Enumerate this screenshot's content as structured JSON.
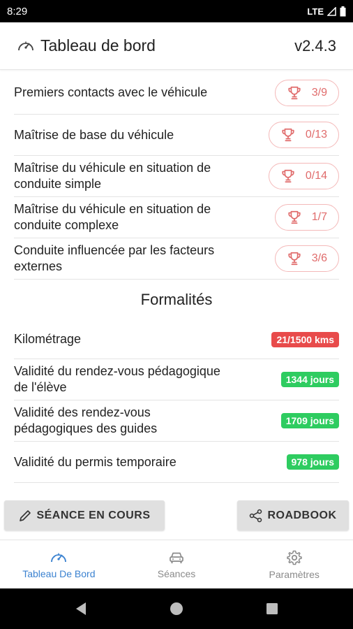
{
  "status_bar": {
    "time": "8:29",
    "network": "LTE"
  },
  "header": {
    "title": "Tableau de bord",
    "version": "v2.4.3",
    "icon": "speedometer-icon"
  },
  "competences": [
    {
      "label_lines": [
        "Premiers contacts avec le véhicule"
      ],
      "score": "3/9"
    },
    {
      "label_lines": [
        "Maîtrise de base du véhicule"
      ],
      "score": "0/13"
    },
    {
      "label_lines": [
        "Maîtrise du véhicule en situation de",
        "conduite simple"
      ],
      "score": "0/14"
    },
    {
      "label_lines": [
        "Maîtrise du véhicule en situation de",
        "conduite complexe"
      ],
      "score": "1/7"
    },
    {
      "label_lines": [
        "Conduite influencée par les facteurs",
        "externes"
      ],
      "score": "3/6"
    }
  ],
  "formalites": {
    "title": "Formalités",
    "items": [
      {
        "label_lines": [
          "Kilométrage"
        ],
        "value": "21/1500 kms",
        "status": "danger"
      },
      {
        "label_lines": [
          "Validité du rendez-vous pédagogique",
          "de l'élève"
        ],
        "value": "1344 jours",
        "status": "ok"
      },
      {
        "label_lines": [
          "Validité des rendez-vous",
          "pédagogiques des guides"
        ],
        "value": "1709 jours",
        "status": "ok"
      },
      {
        "label_lines": [
          "Validité du permis temporaire"
        ],
        "value": "978 jours",
        "status": "ok"
      }
    ]
  },
  "actions": {
    "session_label": "SÉANCE EN COURS",
    "roadbook_label": "ROADBOOK"
  },
  "bottom_nav": [
    {
      "label": "Tableau De Bord",
      "icon": "speedometer-icon",
      "active": true
    },
    {
      "label": "Séances",
      "icon": "car-icon",
      "active": false
    },
    {
      "label": "Paramètres",
      "icon": "gear-icon",
      "active": false
    }
  ],
  "colors": {
    "danger": "#e84b4b",
    "ok": "#2ecc60",
    "accent": "#3b82d0",
    "trophy": "#e06b6b"
  }
}
